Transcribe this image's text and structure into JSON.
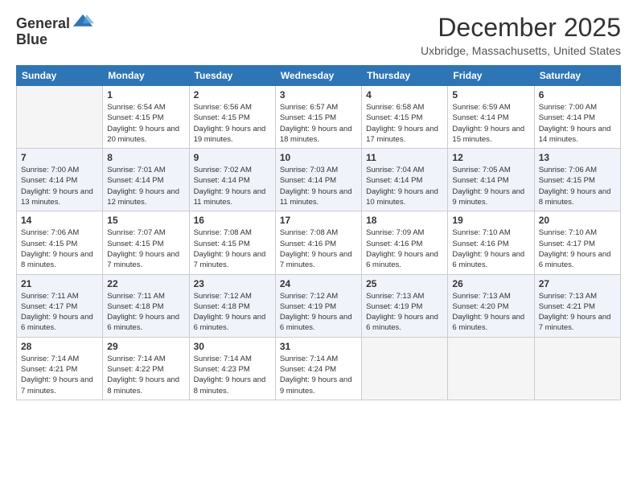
{
  "header": {
    "logo_general": "General",
    "logo_blue": "Blue",
    "month_title": "December 2025",
    "location": "Uxbridge, Massachusetts, United States"
  },
  "days_of_week": [
    "Sunday",
    "Monday",
    "Tuesday",
    "Wednesday",
    "Thursday",
    "Friday",
    "Saturday"
  ],
  "weeks": [
    [
      {
        "day": "",
        "empty": true
      },
      {
        "day": "1",
        "sunrise": "6:54 AM",
        "sunset": "4:15 PM",
        "daylight": "9 hours and 20 minutes."
      },
      {
        "day": "2",
        "sunrise": "6:56 AM",
        "sunset": "4:15 PM",
        "daylight": "9 hours and 19 minutes."
      },
      {
        "day": "3",
        "sunrise": "6:57 AM",
        "sunset": "4:15 PM",
        "daylight": "9 hours and 18 minutes."
      },
      {
        "day": "4",
        "sunrise": "6:58 AM",
        "sunset": "4:15 PM",
        "daylight": "9 hours and 17 minutes."
      },
      {
        "day": "5",
        "sunrise": "6:59 AM",
        "sunset": "4:14 PM",
        "daylight": "9 hours and 15 minutes."
      },
      {
        "day": "6",
        "sunrise": "7:00 AM",
        "sunset": "4:14 PM",
        "daylight": "9 hours and 14 minutes."
      }
    ],
    [
      {
        "day": "7",
        "sunrise": "7:00 AM",
        "sunset": "4:14 PM",
        "daylight": "9 hours and 13 minutes."
      },
      {
        "day": "8",
        "sunrise": "7:01 AM",
        "sunset": "4:14 PM",
        "daylight": "9 hours and 12 minutes."
      },
      {
        "day": "9",
        "sunrise": "7:02 AM",
        "sunset": "4:14 PM",
        "daylight": "9 hours and 11 minutes."
      },
      {
        "day": "10",
        "sunrise": "7:03 AM",
        "sunset": "4:14 PM",
        "daylight": "9 hours and 11 minutes."
      },
      {
        "day": "11",
        "sunrise": "7:04 AM",
        "sunset": "4:14 PM",
        "daylight": "9 hours and 10 minutes."
      },
      {
        "day": "12",
        "sunrise": "7:05 AM",
        "sunset": "4:14 PM",
        "daylight": "9 hours and 9 minutes."
      },
      {
        "day": "13",
        "sunrise": "7:06 AM",
        "sunset": "4:15 PM",
        "daylight": "9 hours and 8 minutes."
      }
    ],
    [
      {
        "day": "14",
        "sunrise": "7:06 AM",
        "sunset": "4:15 PM",
        "daylight": "9 hours and 8 minutes."
      },
      {
        "day": "15",
        "sunrise": "7:07 AM",
        "sunset": "4:15 PM",
        "daylight": "9 hours and 7 minutes."
      },
      {
        "day": "16",
        "sunrise": "7:08 AM",
        "sunset": "4:15 PM",
        "daylight": "9 hours and 7 minutes."
      },
      {
        "day": "17",
        "sunrise": "7:08 AM",
        "sunset": "4:16 PM",
        "daylight": "9 hours and 7 minutes."
      },
      {
        "day": "18",
        "sunrise": "7:09 AM",
        "sunset": "4:16 PM",
        "daylight": "9 hours and 6 minutes."
      },
      {
        "day": "19",
        "sunrise": "7:10 AM",
        "sunset": "4:16 PM",
        "daylight": "9 hours and 6 minutes."
      },
      {
        "day": "20",
        "sunrise": "7:10 AM",
        "sunset": "4:17 PM",
        "daylight": "9 hours and 6 minutes."
      }
    ],
    [
      {
        "day": "21",
        "sunrise": "7:11 AM",
        "sunset": "4:17 PM",
        "daylight": "9 hours and 6 minutes."
      },
      {
        "day": "22",
        "sunrise": "7:11 AM",
        "sunset": "4:18 PM",
        "daylight": "9 hours and 6 minutes."
      },
      {
        "day": "23",
        "sunrise": "7:12 AM",
        "sunset": "4:18 PM",
        "daylight": "9 hours and 6 minutes."
      },
      {
        "day": "24",
        "sunrise": "7:12 AM",
        "sunset": "4:19 PM",
        "daylight": "9 hours and 6 minutes."
      },
      {
        "day": "25",
        "sunrise": "7:13 AM",
        "sunset": "4:19 PM",
        "daylight": "9 hours and 6 minutes."
      },
      {
        "day": "26",
        "sunrise": "7:13 AM",
        "sunset": "4:20 PM",
        "daylight": "9 hours and 6 minutes."
      },
      {
        "day": "27",
        "sunrise": "7:13 AM",
        "sunset": "4:21 PM",
        "daylight": "9 hours and 7 minutes."
      }
    ],
    [
      {
        "day": "28",
        "sunrise": "7:14 AM",
        "sunset": "4:21 PM",
        "daylight": "9 hours and 7 minutes."
      },
      {
        "day": "29",
        "sunrise": "7:14 AM",
        "sunset": "4:22 PM",
        "daylight": "9 hours and 8 minutes."
      },
      {
        "day": "30",
        "sunrise": "7:14 AM",
        "sunset": "4:23 PM",
        "daylight": "9 hours and 8 minutes."
      },
      {
        "day": "31",
        "sunrise": "7:14 AM",
        "sunset": "4:24 PM",
        "daylight": "9 hours and 9 minutes."
      },
      {
        "day": "",
        "empty": true
      },
      {
        "day": "",
        "empty": true
      },
      {
        "day": "",
        "empty": true
      }
    ]
  ],
  "labels": {
    "sunrise": "Sunrise:",
    "sunset": "Sunset:",
    "daylight": "Daylight:"
  }
}
